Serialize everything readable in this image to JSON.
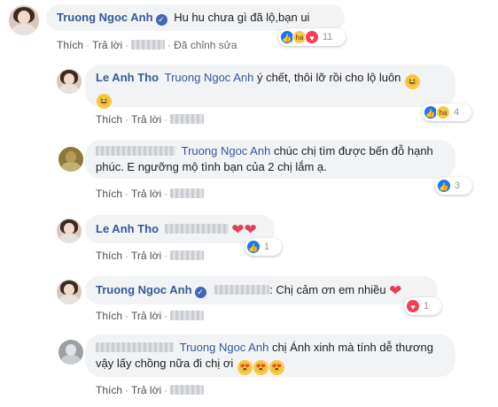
{
  "actions": {
    "like": "Thích",
    "reply": "Trả lời",
    "edited": "Đã chỉnh sửa",
    "separator": "·"
  },
  "comments": [
    {
      "author": "Truong Ngoc Anh",
      "text": "Hu hu chưa gì đã lộ,bạn ui",
      "reaction_count": "11",
      "reactions": [
        "like-icon",
        "haha-icon",
        "love-icon"
      ]
    },
    {
      "author": "Le Anh Tho",
      "mention": "Truong Ngoc Anh",
      "text": "ý chết, thôi lỡ rồi cho lộ luôn",
      "reaction_count": "4",
      "reactions": [
        "like-icon",
        "haha-icon"
      ]
    },
    {
      "mention": "Truong Ngoc Anh",
      "text_line1": "chúc chị tìm được bến đỗ hạnh",
      "text_line2": "phúc. E ngưỡng mộ tình bạn của 2 chị lắm ạ.",
      "reaction_count": "3",
      "reactions": [
        "like-icon"
      ]
    },
    {
      "author": "Le Anh Tho",
      "reaction_count": "1",
      "reactions": [
        "like-icon"
      ]
    },
    {
      "author": "Truong Ngoc Anh",
      "text": ": Chị cảm ơn em nhiều",
      "reaction_count": "1",
      "reactions": [
        "love-icon"
      ]
    },
    {
      "mention": "Truong Ngoc Anh",
      "text_line1": "chị Ánh xinh mà tính dễ thương",
      "text_line2": "vậy lấy chồng nữa đi chị ơi"
    }
  ],
  "colors": {
    "author": "#385898",
    "bubble": "#f2f3f5",
    "like": "#1877f2",
    "love": "#f33e58",
    "haha": "#f7c948"
  }
}
